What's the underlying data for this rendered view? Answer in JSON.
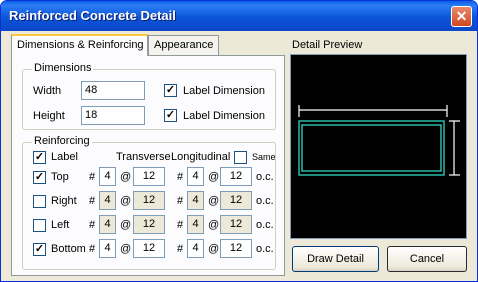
{
  "window": {
    "title": "Reinforced Concrete Detail",
    "close_glyph": "✕"
  },
  "tabs": [
    {
      "label": "Dimensions & Reinforcing",
      "active": true
    },
    {
      "label": "Appearance",
      "active": false
    }
  ],
  "dimensions": {
    "group_label": "Dimensions",
    "width_label": "Width",
    "width_value": "48",
    "height_label": "Height",
    "height_value": "18",
    "width_label_dimension": {
      "label": "Label Dimension",
      "checked": true
    },
    "height_label_dimension": {
      "label": "Label Dimension",
      "checked": true
    }
  },
  "reinforcing": {
    "group_label": "Reinforcing",
    "label_checkbox": {
      "label": "Label",
      "checked": true
    },
    "transverse_header": "Transverse",
    "longitudinal_header": "Longitudinal",
    "same_checkbox": {
      "label": "Same",
      "checked": false
    },
    "hash": "#",
    "at": "@",
    "oc": "o.c.",
    "check_glyph": "✓",
    "rows": [
      {
        "label": "Top",
        "checked": true,
        "t_size": "4",
        "t_spacing": "12",
        "l_size": "4",
        "l_spacing": "12"
      },
      {
        "label": "Right",
        "checked": false,
        "t_size": "4",
        "t_spacing": "12",
        "l_size": "4",
        "l_spacing": "12"
      },
      {
        "label": "Left",
        "checked": false,
        "t_size": "4",
        "t_spacing": "12",
        "l_size": "4",
        "l_spacing": "12"
      },
      {
        "label": "Bottom",
        "checked": true,
        "t_size": "4",
        "t_spacing": "12",
        "l_size": "4",
        "l_spacing": "12"
      }
    ]
  },
  "preview": {
    "label": "Detail Preview",
    "outline_color": "#ffffff",
    "rebar_color": "#2fd6c0"
  },
  "buttons": {
    "draw": "Draw Detail",
    "cancel": "Cancel"
  }
}
